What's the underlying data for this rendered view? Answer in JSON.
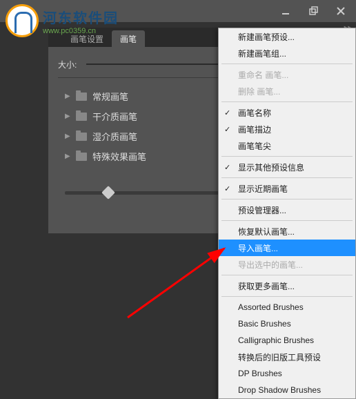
{
  "window": {
    "minimize": "—",
    "restore": "❐",
    "close": "✕"
  },
  "logo": {
    "title": "河东软件园",
    "url": "www.pc0359.cn"
  },
  "tabs": {
    "settings": "画笔设置",
    "brushes": "画笔"
  },
  "panel": {
    "size_label": "大小:",
    "folders": [
      "常规画笔",
      "干介质画笔",
      "湿介质画笔",
      "特殊效果画笔"
    ]
  },
  "menu": {
    "new_preset": "新建画笔预设...",
    "new_group": "新建画笔组...",
    "rename": "重命名 画笔...",
    "delete": "删除 画笔...",
    "brush_name": "画笔名称",
    "brush_stroke": "画笔描边",
    "brush_tip": "画笔笔尖",
    "show_other": "显示其他预设信息",
    "show_recent": "显示近期画笔",
    "preset_manager": "预设管理器...",
    "restore_default": "恢复默认画笔...",
    "import_brushes": "导入画笔...",
    "export_selected": "导出选中的画笔...",
    "get_more": "获取更多画笔...",
    "assorted": "Assorted Brushes",
    "basic": "Basic Brushes",
    "calligraphic": "Calligraphic Brushes",
    "converted": "转换后的旧版工具预设",
    "dp": "DP Brushes",
    "drop_shadow": "Drop Shadow Brushes"
  }
}
